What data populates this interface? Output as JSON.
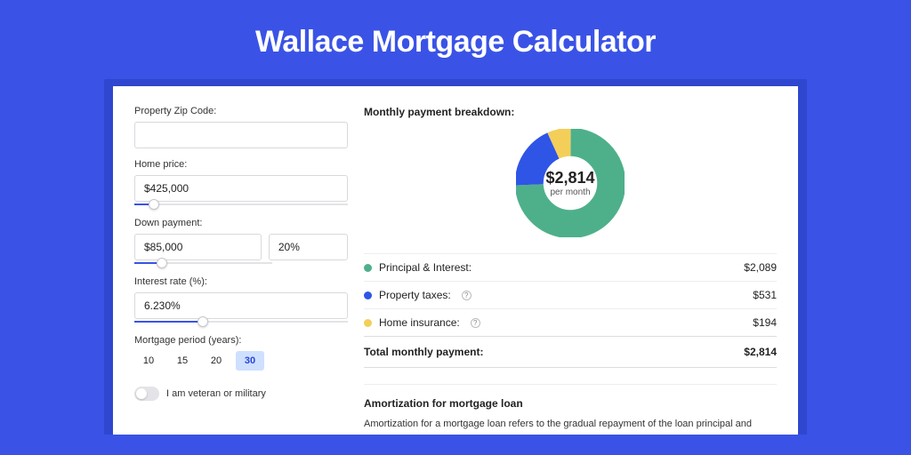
{
  "page": {
    "title": "Wallace Mortgage Calculator"
  },
  "form": {
    "zip_label": "Property Zip Code:",
    "zip_value": "",
    "home_price_label": "Home price:",
    "home_price_value": "$425,000",
    "home_price_slider_pct": 9,
    "down_payment_label": "Down payment:",
    "down_payment_value": "$85,000",
    "down_payment_pct_value": "20%",
    "down_payment_slider_pct": 20,
    "interest_label": "Interest rate (%):",
    "interest_value": "6.230%",
    "interest_slider_pct": 32,
    "period_label": "Mortgage period (years):",
    "period_options": [
      "10",
      "15",
      "20",
      "30"
    ],
    "period_selected": "30",
    "veteran_label": "I am veteran or military",
    "veteran_checked": false
  },
  "breakdown": {
    "title": "Monthly payment breakdown:",
    "center_amount": "$2,814",
    "center_sub": "per month",
    "rows": [
      {
        "label": "Principal & Interest:",
        "value": "$2,089",
        "color": "#4eb08b",
        "help": false
      },
      {
        "label": "Property taxes:",
        "value": "$531",
        "color": "#2f55e6",
        "help": true
      },
      {
        "label": "Home insurance:",
        "value": "$194",
        "color": "#f3cf5a",
        "help": true
      }
    ],
    "total_label": "Total monthly payment:",
    "total_value": "$2,814"
  },
  "amortization": {
    "title": "Amortization for mortgage loan",
    "text": "Amortization for a mortgage loan refers to the gradual repayment of the loan principal and interest over a specified"
  },
  "chart_data": {
    "type": "pie",
    "title": "Monthly payment breakdown",
    "series": [
      {
        "name": "Principal & Interest",
        "value": 2089,
        "color": "#4eb08b"
      },
      {
        "name": "Property taxes",
        "value": 531,
        "color": "#2f55e6"
      },
      {
        "name": "Home insurance",
        "value": 194,
        "color": "#f3cf5a"
      }
    ],
    "total": 2814,
    "center_label": "$2,814 per month",
    "donut": true
  }
}
